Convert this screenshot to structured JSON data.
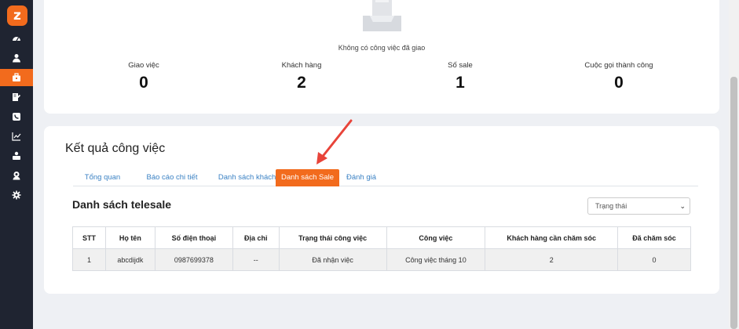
{
  "sidebar": {
    "logo_text": "z",
    "accent": "#f26b1d",
    "icons": [
      "dashboard-icon",
      "user-icon",
      "briefcase-icon",
      "edit-icon",
      "phone-icon",
      "chart-icon",
      "user-group-icon",
      "support-icon",
      "gear-icon"
    ],
    "active_index": 2
  },
  "overview": {
    "empty_text": "Không có công việc đã giao",
    "stats": [
      {
        "label": "Giao việc",
        "value": "0"
      },
      {
        "label": "Khách hàng",
        "value": "2"
      },
      {
        "label": "Số sale",
        "value": "1"
      },
      {
        "label": "Cuộc gọi thành công",
        "value": "0"
      }
    ]
  },
  "result": {
    "title": "Kết quả công việc",
    "tabs": [
      "Tổng quan",
      "Báo cáo chi tiết",
      "Danh sách khách hàng",
      "Danh sách Sale",
      "Đánh giá"
    ],
    "active_tab": 3,
    "subtitle": "Danh sách telesale",
    "status_select": {
      "placeholder": "Trạng thái"
    },
    "table": {
      "headers": [
        "STT",
        "Họ tên",
        "Số điện thoại",
        "Địa chỉ",
        "Trạng thái công việc",
        "Công việc",
        "Khách hàng cần chăm sóc",
        "Đã chăm sóc"
      ],
      "rows": [
        [
          "1",
          "abcdijdk",
          "0987699378",
          "--",
          "Đã nhận việc",
          "Công việc tháng 10",
          "2",
          "0"
        ]
      ]
    }
  }
}
